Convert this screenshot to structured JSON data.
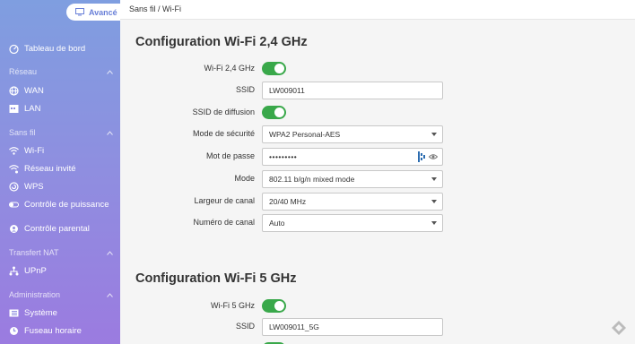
{
  "sidebar": {
    "advanced_label": "Avancé",
    "dashboard": "Tableau de bord",
    "sections": {
      "network": "Réseau",
      "wireless": "Sans fil",
      "nat": "Transfert NAT",
      "admin": "Administration"
    },
    "items": {
      "wan": "WAN",
      "lan": "LAN",
      "wifi": "Wi-Fi",
      "guest": "Réseau invité",
      "wps": "WPS",
      "power": "Contrôle de puissance",
      "parental": "Contrôle parental",
      "upnp": "UPnP",
      "system": "Système",
      "timezone": "Fuseau horaire"
    }
  },
  "breadcrumb": "Sans fil / Wi-Fi",
  "wifi24": {
    "title": "Configuration Wi-Fi 2,4 GHz",
    "enable_label": "Wi-Fi 2,4 GHz",
    "ssid_label": "SSID",
    "ssid_value": "LW009011",
    "broadcast_label": "SSID de diffusion",
    "security_label": "Mode de sécurité",
    "security_value": "WPA2 Personal-AES",
    "password_label": "Mot de passe",
    "password_value": "•••••••••",
    "mode_label": "Mode",
    "mode_value": "802.11 b/g/n mixed mode",
    "width_label": "Largeur de canal",
    "width_value": "20/40 MHz",
    "channel_label": "Numéro de canal",
    "channel_value": "Auto"
  },
  "wifi5": {
    "title": "Configuration Wi-Fi 5 GHz",
    "enable_label": "Wi-Fi 5 GHz",
    "ssid_label": "SSID",
    "ssid_value": "LW009011_5G"
  },
  "colors": {
    "accent": "#39a84a",
    "sidebar_top": "#7f9ee0",
    "sidebar_bottom": "#9b7be0"
  }
}
